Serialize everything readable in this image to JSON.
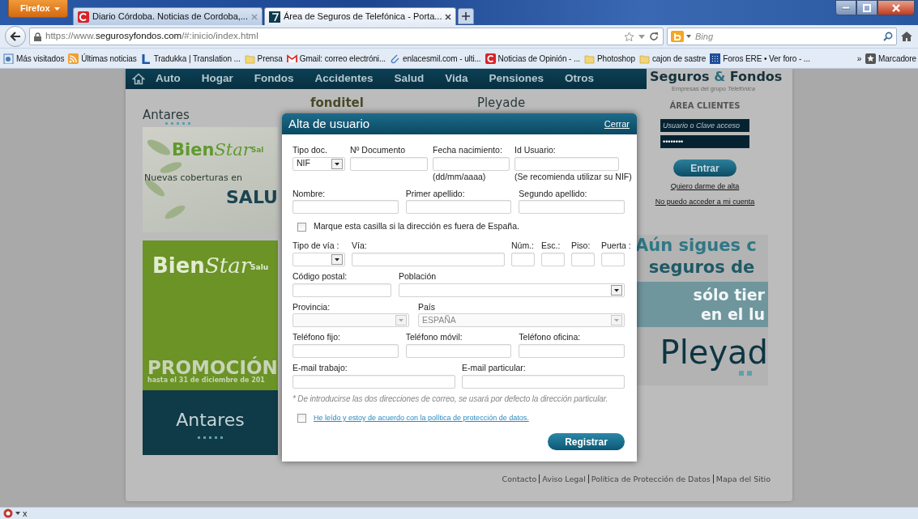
{
  "browser": {
    "menu_button": "Firefox",
    "tabs": [
      {
        "title": "Diario Córdoba. Noticias de Cordoba,...",
        "selected": false
      },
      {
        "title": "Área de Seguros de Telefónica - Porta...",
        "selected": true
      }
    ],
    "url": "https://www.**segurosyfondos.com**/#:inicio/index.html",
    "search_placeholder": "Bing",
    "bookmarks": [
      {
        "label": "Más visitados"
      },
      {
        "label": "Últimas noticias"
      },
      {
        "label": "Tradukka | Translation ..."
      },
      {
        "label": "Prensa"
      },
      {
        "label": "Gmail: correo electróni..."
      },
      {
        "label": "enlacesmil.com - ulti..."
      },
      {
        "label": "Noticias de Opinión - ..."
      },
      {
        "label": "Photoshop"
      },
      {
        "label": "cajon de sastre"
      },
      {
        "label": "Foros ERE • Ver foro - ..."
      }
    ],
    "bookmarks_overflow": "»",
    "bookmarks_menu": "Marcadore"
  },
  "site": {
    "nav": [
      "Auto",
      "Hogar",
      "Fondos",
      "Accidentes",
      "Salud",
      "Vida",
      "Pensiones",
      "Otros"
    ],
    "logo": [
      "Seguros",
      "&",
      "Fondos"
    ],
    "tagline": "Empresas del grupo *Telefónica*",
    "brands": [
      "Antares",
      "fonditel",
      "Pleyade"
    ],
    "banner_1": {
      "logo": [
        "Bien",
        "Star",
        "Sal"
      ],
      "text": "Nuevas coberturas en",
      "highlight": "SALU"
    },
    "banner_2": {
      "logo": [
        "Bien",
        "Star",
        "Salu"
      ],
      "promo": "PROMOCIÓN",
      "promo_note": "hasta el 31 de diciembre de 201",
      "brand": "Antares"
    },
    "login": {
      "title": "ÁREA CLIENTES",
      "user_placeholder": "Usuario o Clave acceso",
      "password": "••••••••",
      "submit": "Entrar",
      "links": [
        "Quiero darme de alta",
        "No puedo acceder a mi cuenta"
      ]
    },
    "banner_3": {
      "lines": [
        "Aún sigues c",
        "seguros de"
      ],
      "strip": [
        "sólo tier",
        "en el lu"
      ],
      "brand": "Pleyad"
    },
    "footer": [
      "Contacto",
      "Aviso Legal",
      "Política de Protección de Datos",
      "Mapa del Sitio"
    ]
  },
  "modal": {
    "title": "Alta de usuario",
    "close": "Cerrar",
    "rows": [
      {
        "kind": "fields",
        "fields": [
          {
            "kind": "select",
            "label": "Tipo doc.",
            "value": "NIF",
            "disabled": false
          },
          {
            "kind": "input",
            "label": "Nº Documento",
            "disabled": false
          },
          {
            "kind": "input",
            "label": "Fecha nacimiento:",
            "hint": "(dd/mm/aaaa)",
            "disabled": false
          },
          {
            "kind": "input",
            "label": "Id Usuario:",
            "hint": "(Se recomienda utilizar su NIF)",
            "disabled": false
          }
        ]
      },
      {
        "kind": "fields",
        "fields": [
          {
            "kind": "input",
            "label": "Nombre:",
            "disabled": false
          },
          {
            "kind": "input",
            "label": "Primer apellido:",
            "disabled": false
          },
          {
            "kind": "input",
            "label": "Segundo apellido:",
            "disabled": false
          }
        ]
      },
      {
        "kind": "checkbox",
        "label": "Marque esta casilla si la dirección es fuera de España.",
        "checked": false
      },
      {
        "kind": "fields",
        "fields": [
          {
            "kind": "select",
            "label": "Tipo de vía :",
            "disabled": false
          },
          {
            "kind": "input",
            "label": "Vía:",
            "disabled": false
          },
          {
            "kind": "input",
            "label": "Núm.:",
            "disabled": false
          },
          {
            "kind": "input",
            "label": "Esc.:",
            "disabled": false
          },
          {
            "kind": "input",
            "label": "Piso:",
            "disabled": false
          },
          {
            "kind": "input",
            "label": "Puerta :",
            "disabled": false
          }
        ]
      },
      {
        "kind": "fields",
        "fields": [
          {
            "kind": "input",
            "label": "Código postal:",
            "disabled": false
          },
          {
            "kind": "select",
            "label": "Población",
            "disabled": false
          }
        ]
      },
      {
        "kind": "fields",
        "fields": [
          {
            "kind": "select",
            "label": "Provincia:",
            "disabled": true
          },
          {
            "kind": "select",
            "label": "País",
            "value": "ESPAÑA",
            "disabled": true
          }
        ]
      },
      {
        "kind": "fields",
        "fields": [
          {
            "kind": "input",
            "label": "Teléfono fijo:",
            "disabled": false
          },
          {
            "kind": "input",
            "label": "Teléfono móvil:",
            "disabled": false
          },
          {
            "kind": "input",
            "label": "Teléfono oficina:",
            "disabled": false
          }
        ]
      },
      {
        "kind": "fields",
        "fields": [
          {
            "kind": "input",
            "label": "E-mail trabajo:",
            "disabled": false
          },
          {
            "kind": "input",
            "label": "E-mail particular:",
            "disabled": false
          }
        ]
      }
    ],
    "note": "* De introducirse las dos direcciones de correo, se usará por defecto la dirección particular.",
    "consent": {
      "label": "He leído y estoy de acuerdo con la política de protección de datos.",
      "checked": false
    },
    "submit": "Registrar"
  },
  "status_bar": {
    "close": "x"
  }
}
